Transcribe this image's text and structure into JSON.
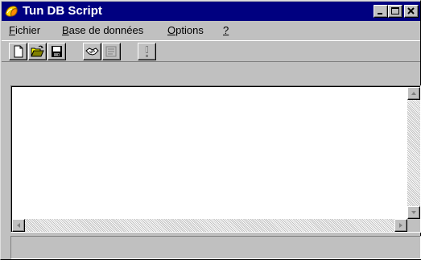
{
  "window": {
    "title": "Tun DB Script",
    "app_icon": "tun-db-script-app-icon"
  },
  "title_buttons": {
    "minimize_icon": "minimize-icon",
    "maximize_icon": "maximize-icon",
    "close_icon": "close-icon"
  },
  "menu": {
    "items": [
      {
        "label": "Fichier",
        "accel": "F",
        "rest": "ichier"
      },
      {
        "label": "Base de données",
        "accel": "B",
        "rest": "ase de données"
      },
      {
        "label": "Options",
        "accel": "O",
        "rest": "ptions"
      },
      {
        "label": "?",
        "accel": "?",
        "rest": ""
      }
    ]
  },
  "toolbar": {
    "buttons": [
      {
        "name": "new-button",
        "icon": "new-document-icon"
      },
      {
        "name": "open-button",
        "icon": "open-folder-icon"
      },
      {
        "name": "save-button",
        "icon": "save-disk-icon"
      },
      {
        "name": "connect-button",
        "icon": "handshake-icon"
      },
      {
        "name": "edit-button",
        "icon": "script-edit-icon"
      },
      {
        "name": "execute-button",
        "icon": "exclamation-icon"
      }
    ]
  },
  "scrollbars": {
    "up_icon": "arrow-up-icon",
    "down_icon": "arrow-down-icon",
    "left_icon": "arrow-left-icon",
    "right_icon": "arrow-right-icon"
  },
  "status": {
    "text": ""
  },
  "colors": {
    "titlebar": "#000080",
    "face": "#c0c0c0",
    "client": "#ffffff"
  }
}
